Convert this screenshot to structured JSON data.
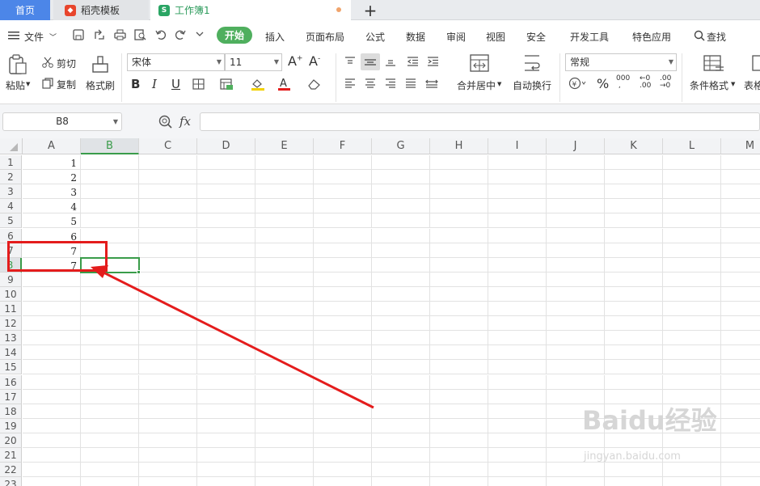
{
  "tabs": {
    "home": "首页",
    "templates": "稻壳模板",
    "workbook": "工作簿1"
  },
  "menubar": {
    "file": "文件",
    "items": [
      "开始",
      "插入",
      "页面布局",
      "公式",
      "数据",
      "审阅",
      "视图",
      "安全",
      "开发工具",
      "特色应用"
    ],
    "search": "查找"
  },
  "ribbon": {
    "paste": "粘贴",
    "cut": "剪切",
    "copy": "复制",
    "format_painter": "格式刷",
    "font_name": "宋体",
    "font_size": "11",
    "merge_center": "合并居中",
    "wrap_text": "自动换行",
    "number_format": "常规",
    "conditional_format": "条件格式",
    "table_style": "表格"
  },
  "formula_bar": {
    "name_box": "B8",
    "fx": "fx",
    "value": ""
  },
  "sheet": {
    "columns": [
      "A",
      "B",
      "C",
      "D",
      "E",
      "F",
      "G",
      "H",
      "I",
      "J",
      "K",
      "L",
      "M"
    ],
    "rows": [
      "1",
      "2",
      "3",
      "4",
      "5",
      "6",
      "7",
      "8",
      "9",
      "10",
      "11",
      "12",
      "13",
      "14",
      "15",
      "16",
      "17",
      "18",
      "19",
      "20",
      "21",
      "22",
      "23"
    ],
    "column_a_values": [
      "1",
      "2",
      "3",
      "4",
      "5",
      "6",
      "7",
      "7"
    ],
    "selected_cell": "B8"
  },
  "annotation_color": "#e41c1c",
  "accent_green": "#4faf5e",
  "watermark": {
    "main": "Baidu经验",
    "sub": "jingyan.baidu.com"
  }
}
